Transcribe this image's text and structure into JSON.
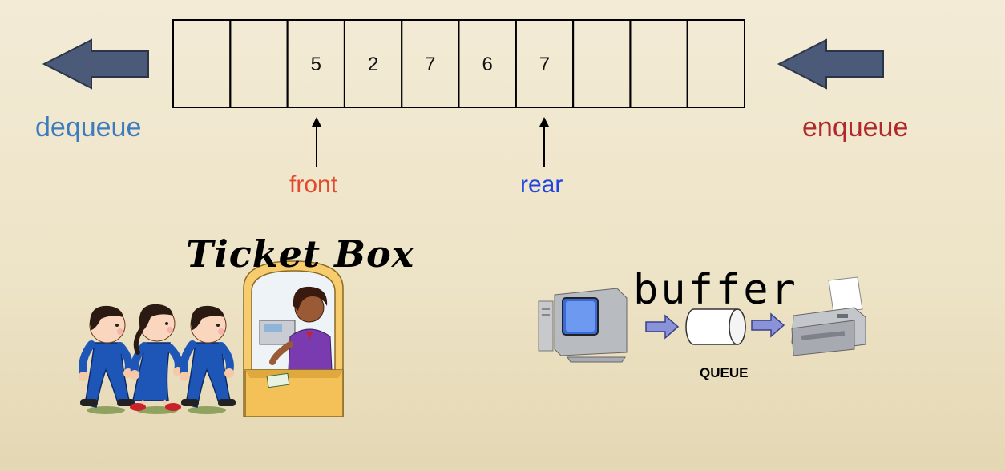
{
  "queue": {
    "cells": [
      "",
      "",
      "5",
      "2",
      "7",
      "6",
      "7",
      "",
      "",
      ""
    ]
  },
  "labels": {
    "dequeue": "dequeue",
    "enqueue": "enqueue",
    "front": "front",
    "rear": "rear",
    "ticket_box": "Ticket Box",
    "buffer": "buffer",
    "queue_caption": "QUEUE"
  },
  "colors": {
    "arrow_fill": "#4a5a78",
    "dequeue": "#3d7bbf",
    "enqueue": "#b0282a",
    "front": "#e24a2e",
    "rear": "#1f44e0",
    "transfer_arrow": "#8a92d8"
  },
  "icons": [
    "left-arrow-icon",
    "computer-icon",
    "printer-icon",
    "cylinder-queue-icon",
    "people-walking-illustration",
    "ticket-booth-illustration"
  ]
}
